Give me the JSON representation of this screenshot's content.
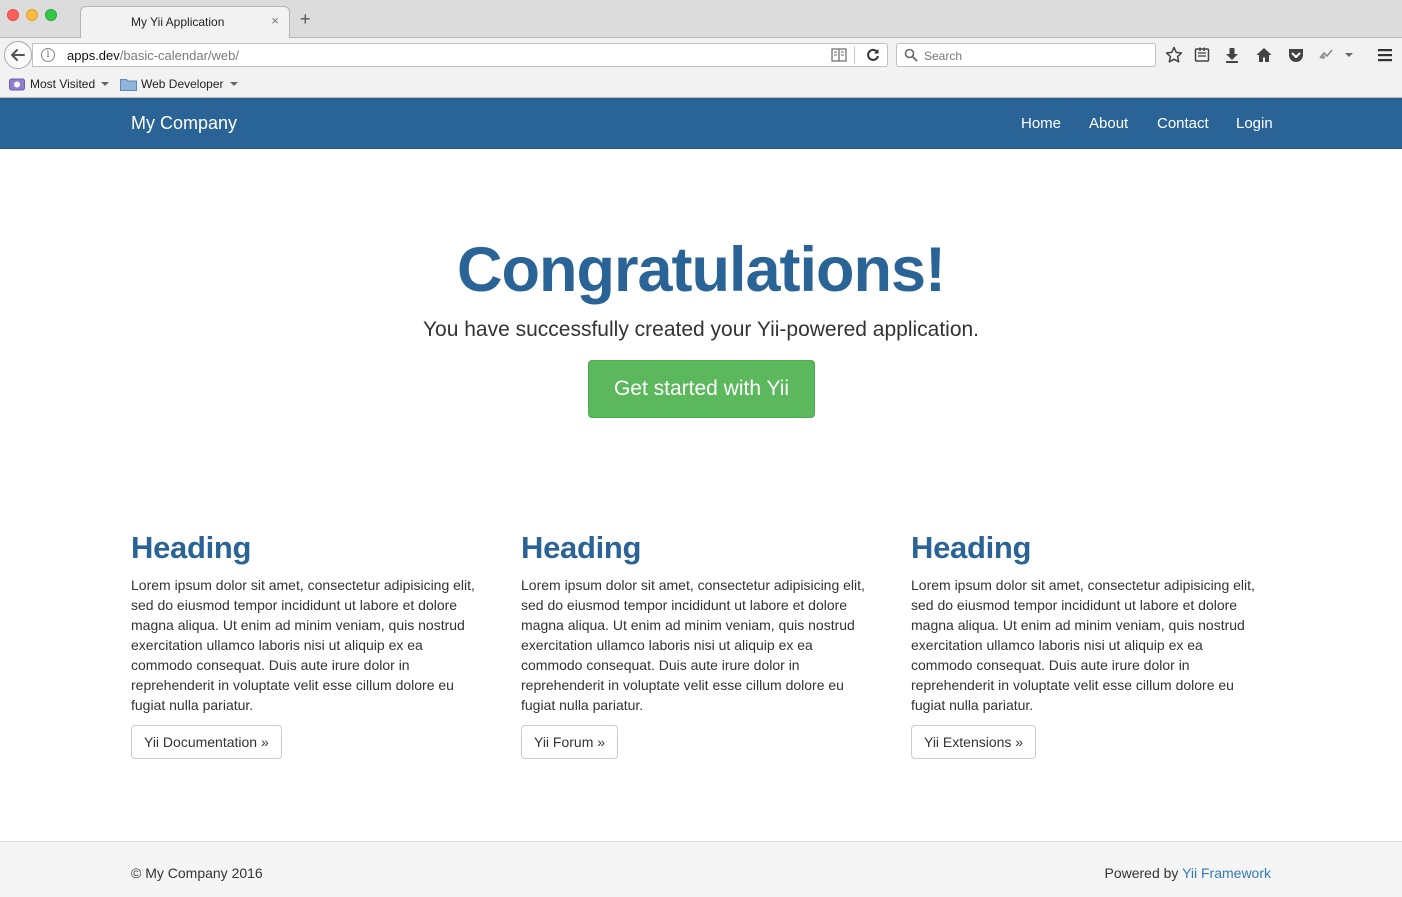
{
  "browser": {
    "tab_title": "My Yii Application",
    "tab_close": "×",
    "new_tab": "+",
    "url_host": "apps.dev",
    "url_path": "/basic-calendar/web/",
    "search_placeholder": "Search",
    "bookmarks": [
      {
        "label": "Most Visited"
      },
      {
        "label": "Web Developer"
      }
    ]
  },
  "site": {
    "brand": "My Company",
    "nav": [
      {
        "label": "Home"
      },
      {
        "label": "About"
      },
      {
        "label": "Contact"
      },
      {
        "label": "Login"
      }
    ]
  },
  "jumbotron": {
    "title": "Congratulations!",
    "lead": "You have successfully created your Yii-powered application.",
    "button": "Get started with Yii"
  },
  "columns": [
    {
      "heading": "Heading",
      "body": "Lorem ipsum dolor sit amet, consectetur adipisicing elit, sed do eiusmod tempor incididunt ut labore et dolore magna aliqua. Ut enim ad minim veniam, quis nostrud exercitation ullamco laboris nisi ut aliquip ex ea commodo consequat. Duis aute irure dolor in reprehenderit in voluptate velit esse cillum dolore eu fugiat nulla pariatur.",
      "button": "Yii Documentation »"
    },
    {
      "heading": "Heading",
      "body": "Lorem ipsum dolor sit amet, consectetur adipisicing elit, sed do eiusmod tempor incididunt ut labore et dolore magna aliqua. Ut enim ad minim veniam, quis nostrud exercitation ullamco laboris nisi ut aliquip ex ea commodo consequat. Duis aute irure dolor in reprehenderit in voluptate velit esse cillum dolore eu fugiat nulla pariatur.",
      "button": "Yii Forum »"
    },
    {
      "heading": "Heading",
      "body": "Lorem ipsum dolor sit amet, consectetur adipisicing elit, sed do eiusmod tempor incididunt ut labore et dolore magna aliqua. Ut enim ad minim veniam, quis nostrud exercitation ullamco laboris nisi ut aliquip ex ea commodo consequat. Duis aute irure dolor in reprehenderit in voluptate velit esse cillum dolore eu fugiat nulla pariatur.",
      "button": "Yii Extensions »"
    }
  ],
  "footer": {
    "copyright": "© My Company 2016",
    "powered_prefix": "Powered by ",
    "powered_link": "Yii Framework"
  },
  "colors": {
    "navbar": "#2a6496",
    "heading": "#2a6496",
    "success": "#5cb85c",
    "link": "#337ab7"
  },
  "icons": {
    "toolbar": [
      "star-icon",
      "reading-list-icon",
      "download-icon",
      "home-icon",
      "pocket-icon",
      "extension-icon",
      "menu-icon"
    ]
  }
}
